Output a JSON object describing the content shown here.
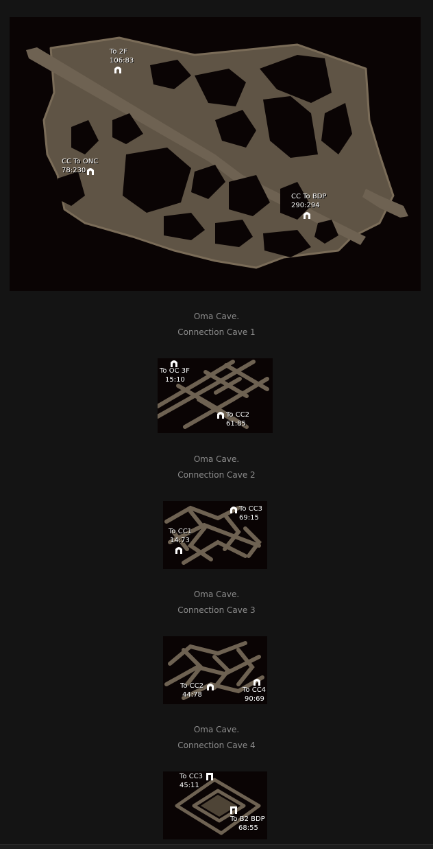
{
  "maps": [
    {
      "id": "main",
      "labels": [
        {
          "name": "To 2F",
          "coords": "106:83"
        },
        {
          "name": "CC To ONC",
          "coords": "78:230"
        },
        {
          "name": "CC To BDP",
          "coords": "290:294"
        }
      ]
    },
    {
      "id": "cc1",
      "caption": {
        "line1": "Oma Cave.",
        "line2": "Connection Cave 1"
      },
      "labels": [
        {
          "name": "To OC 3F",
          "coords": "15:10"
        },
        {
          "name": "To CC2",
          "coords": "61:85"
        }
      ]
    },
    {
      "id": "cc2",
      "caption": {
        "line1": "Oma Cave.",
        "line2": "Connection Cave 2"
      },
      "labels": [
        {
          "name": "To CC3",
          "coords": "69:15"
        },
        {
          "name": "To CC1",
          "coords": "14:73"
        }
      ]
    },
    {
      "id": "cc3",
      "caption": {
        "line1": "Oma Cave.",
        "line2": "Connection Cave 3"
      },
      "labels": [
        {
          "name": "To CC2",
          "coords": "44:78"
        },
        {
          "name": "To CC4",
          "coords": "90:69"
        }
      ]
    },
    {
      "id": "cc4",
      "caption": {
        "line1": "Oma Cave.",
        "line2": "Connection Cave 4"
      },
      "labels": [
        {
          "name": "To CC3",
          "coords": "45:11"
        },
        {
          "name": "To B2 BDP",
          "coords": "68:55"
        }
      ]
    }
  ],
  "colors": {
    "page_bg": "#141414",
    "map_bg": "#0a0404",
    "cave_floor": "#6e6252",
    "caption_text": "#8c8c8c"
  }
}
